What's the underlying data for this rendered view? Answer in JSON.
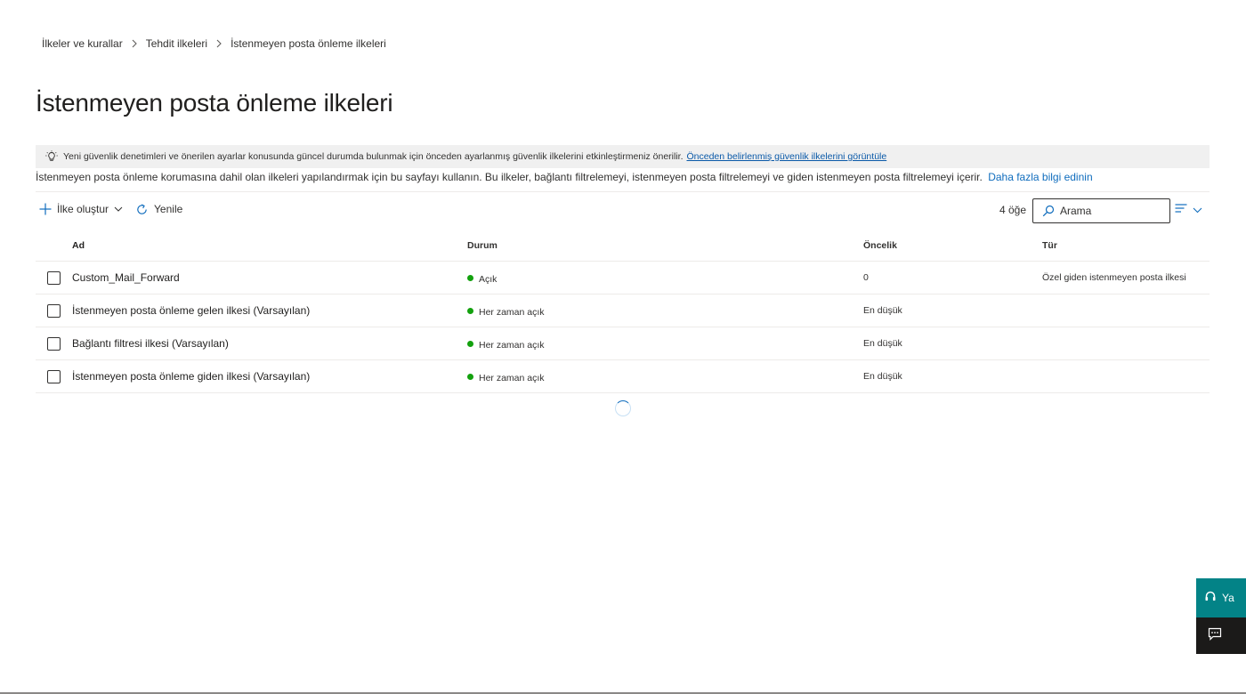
{
  "breadcrumb": {
    "items": [
      "İlkeler ve kurallar",
      "Tehdit ilkeleri",
      "İstenmeyen posta önleme ilkeleri"
    ]
  },
  "page": {
    "title": "İstenmeyen posta önleme ilkeleri"
  },
  "banner": {
    "text": "Yeni güvenlik denetimleri ve önerilen ayarlar konusunda güncel durumda bulunmak için önceden ayarlanmış güvenlik ilkelerini etkinleştirmeniz önerilir.",
    "link": "Önceden belirlenmiş güvenlik ilkelerini görüntüle"
  },
  "description": {
    "text": "İstenmeyen posta önleme korumasına dahil olan ilkeleri yapılandırmak için bu sayfayı kullanın. Bu ilkeler, bağlantı filtrelemeyi, istenmeyen posta filtrelemeyi ve giden istenmeyen posta filtrelemeyi içerir.",
    "link": "Daha fazla bilgi edinin"
  },
  "toolbar": {
    "create_label": "İlke oluştur",
    "refresh_label": "Yenile",
    "count": "4 öğe",
    "search_placeholder": "Arama"
  },
  "table": {
    "headers": {
      "name": "Ad",
      "status": "Durum",
      "priority": "Öncelik",
      "type": "Tür"
    },
    "rows": [
      {
        "name": "Custom_Mail_Forward",
        "status": "Açık",
        "priority": "0",
        "type": "Özel giden istenmeyen posta ilkesi"
      },
      {
        "name": "İstenmeyen posta önleme gelen ilkesi (Varsayılan)",
        "status": "Her zaman açık",
        "priority": "En düşük",
        "type": ""
      },
      {
        "name": "Bağlantı filtresi ilkesi (Varsayılan)",
        "status": "Her zaman açık",
        "priority": "En düşük",
        "type": ""
      },
      {
        "name": "İstenmeyen posta önleme giden ilkesi (Varsayılan)",
        "status": "Her zaman açık",
        "priority": "En düşük",
        "type": ""
      }
    ]
  },
  "help": {
    "label": "Ya"
  },
  "colors": {
    "status_on": "#13a10e",
    "link": "#0f6cbd",
    "help_bg": "#038387",
    "feedback_bg": "#1b1a19"
  }
}
